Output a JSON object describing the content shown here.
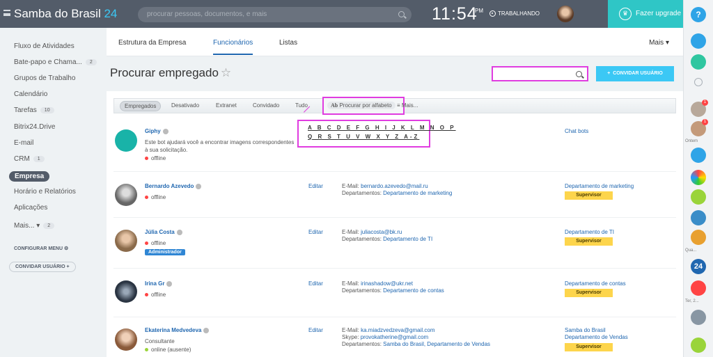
{
  "header": {
    "logo": "Samba do Brasil",
    "logo_num": "24",
    "search_placeholder": "procurar pessoas, documentos, e mais",
    "time": "11:54",
    "ampm": "PM",
    "status": "TRABALHANDO",
    "upgrade": "Fazer upgrade",
    "help": "?"
  },
  "sidebar": {
    "items": [
      {
        "label": "Fluxo de Atividades"
      },
      {
        "label": "Bate-papo e Chama...",
        "count": "2"
      },
      {
        "label": "Grupos de Trabalho"
      },
      {
        "label": "Calendário"
      },
      {
        "label": "Tarefas",
        "count": "10"
      },
      {
        "label": "Bitrix24.Drive"
      },
      {
        "label": "E-mail"
      },
      {
        "label": "CRM",
        "count": "1"
      },
      {
        "label": "Empresa"
      },
      {
        "label": "Horário e Relatórios"
      },
      {
        "label": "Aplicações"
      },
      {
        "label": "Mais...",
        "count": "2"
      }
    ],
    "config": "CONFIGURAR MENU",
    "invite": "CONVIDAR USUÁRIO"
  },
  "tabs": [
    {
      "label": "Estrutura da Empresa"
    },
    {
      "label": "Funcionários"
    },
    {
      "label": "Listas"
    }
  ],
  "more_tab": "Mais",
  "page": {
    "title": "Procurar empregado",
    "invite_button": "CONVIDAR USUÁRIO"
  },
  "filters": [
    "Empregados",
    "Desativado",
    "Extranet",
    "Convidado",
    "Tudo",
    "Procurar por alfabeto",
    "Mais..."
  ],
  "alphabet": {
    "row1": "A B C D E F G H I J K L M N O P",
    "row2": "Q R S T U V W X Y Z A-Z"
  },
  "rightbar": {
    "ontem": "Ontem",
    "qua": "Qua...",
    "ter": "Ter, 2..."
  },
  "employees": [
    {
      "name": "Giphy",
      "desc1": "Este bot ajudará você a encontrar imagens correspondentes",
      "desc2": "à sua solicitação.",
      "status": "offline",
      "dept": "Chat bots"
    },
    {
      "name": "Bernardo Azevedo",
      "status": "offline",
      "editar": "Editar",
      "email_label": "E-Mail:",
      "email": "bernardo.azevedo@mail.ru",
      "dept_label": "Departamentos:",
      "depts": "Departamento de marketing",
      "dept": "Departamento de marketing",
      "role": "Supervisor"
    },
    {
      "name": "Júlia Costa",
      "status": "offline",
      "editar": "Editar",
      "email_label": "E-Mail:",
      "email": "juliacosta@bk.ru",
      "dept_label": "Departamentos:",
      "depts": "Departamento de TI",
      "dept": "Departamento de TI",
      "role": "Supervisor",
      "admin": "Administrador"
    },
    {
      "name": "Irina Gr",
      "status": "offline",
      "editar": "Editar",
      "email_label": "E-Mail:",
      "email": "irinashadow@ukr.net",
      "dept_label": "Departamentos:",
      "depts": "Departamento de contas",
      "dept": "Departamento de contas",
      "role": "Supervisor"
    },
    {
      "name": "Ekaterina Medvedeva",
      "position": "Consultante",
      "status": "online (ausente)",
      "editar": "Editar",
      "email_label": "E-Mail:",
      "email": "ka.miadzvedzeva@gmail.com",
      "skype_label": "Skype:",
      "skype": "provokatherine@gmail.com",
      "dept_label": "Departamentos:",
      "depts": "Samba do Brasil, Departamento de Vendas",
      "dept1": "Samba do Brasil",
      "dept2": "Departamento de Vendas",
      "role": "Supervisor"
    }
  ]
}
